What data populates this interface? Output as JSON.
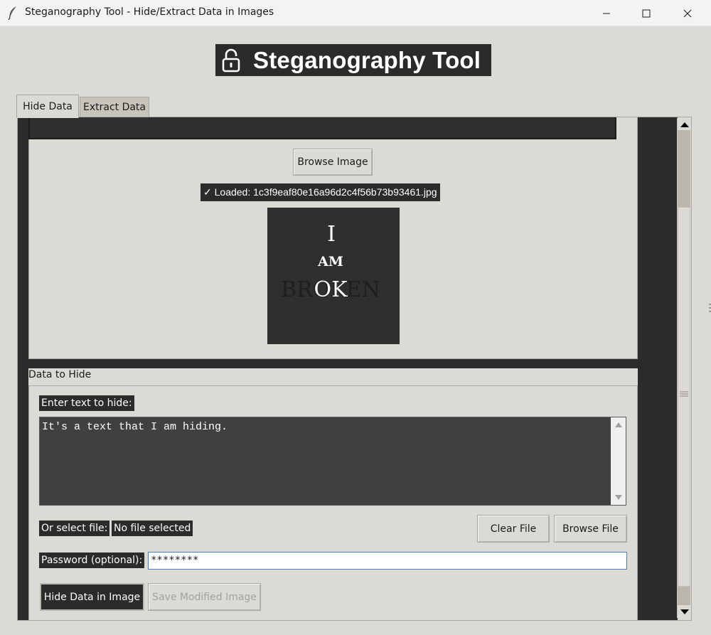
{
  "window": {
    "title": "Steganography Tool - Hide/Extract Data in Images",
    "app_icon": "feather-icon"
  },
  "header": {
    "icon": "lock-icon",
    "title": "Steganography Tool"
  },
  "tabs": [
    {
      "label": "Hide Data",
      "active": true
    },
    {
      "label": "Extract Data",
      "active": false
    }
  ],
  "image_section": {
    "browse_label": "Browse Image",
    "loaded_text": "✓ Loaded: 1c3f9eaf80e16a96d2c4f56b73b93461.jpg",
    "preview": {
      "line1": "I",
      "line2": "AM",
      "line3_faded": "BROKEN",
      "line3_bright": "OK"
    }
  },
  "data_section": {
    "frame_label": "Data to Hide",
    "text_label": "Enter text to hide:",
    "text_value": "It's a text that I am hiding.",
    "file_label": "Or select file:",
    "file_status": "No file selected",
    "clear_file_label": "Clear File",
    "browse_file_label": "Browse File",
    "password_label": "Password (optional):",
    "password_value": "********",
    "hide_button_label": "Hide Data in Image",
    "save_button_label": "Save Modified Image"
  },
  "colors": {
    "background": "#dcdad5",
    "dark": "#2b2b2b",
    "accent_border": "#4a7eb5"
  }
}
